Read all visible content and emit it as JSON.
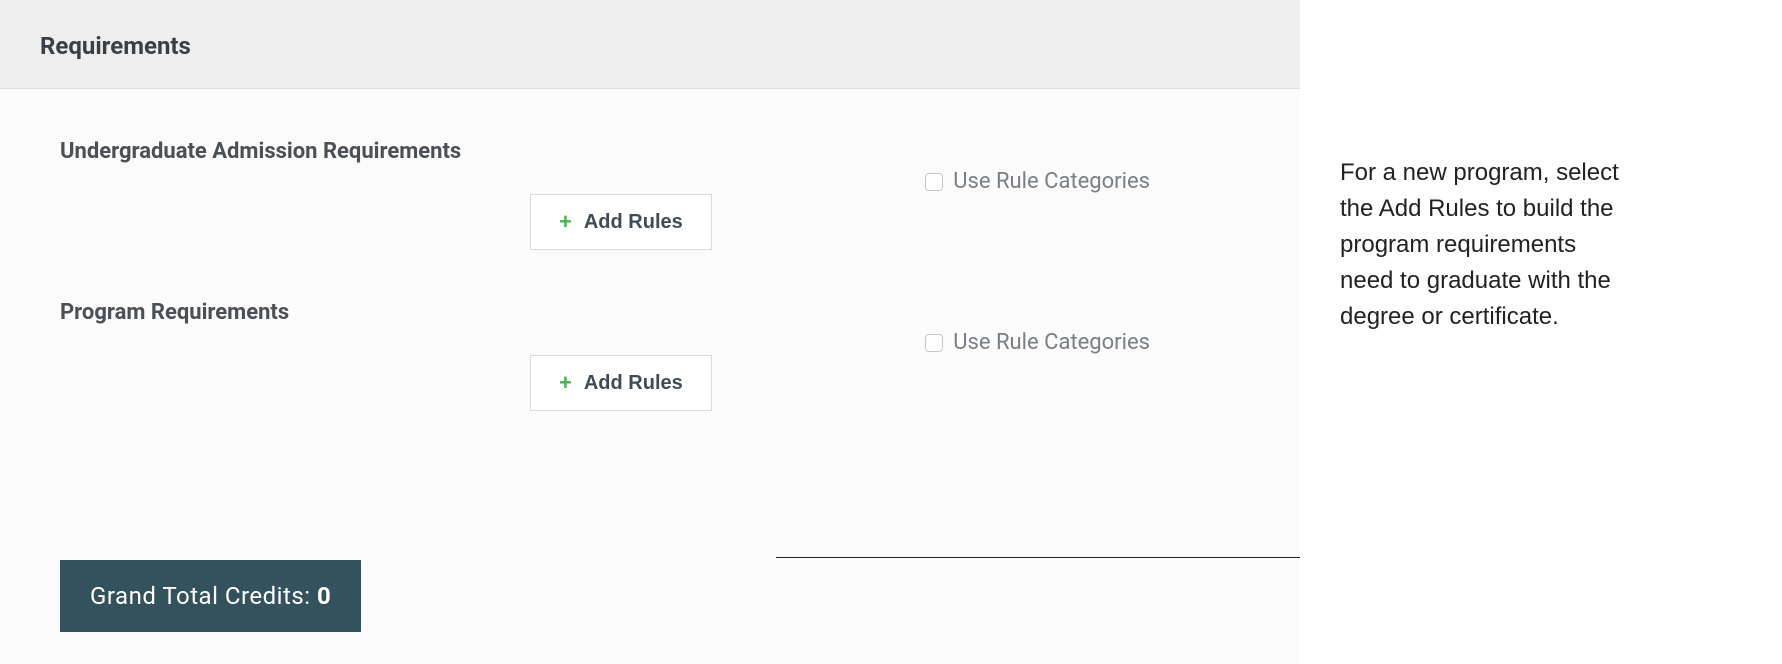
{
  "panel": {
    "title": "Requirements"
  },
  "sections": {
    "admission": {
      "title": "Undergraduate Admission Requirements",
      "checkbox_label": "Use Rule Categories",
      "add_button_label": "Add Rules"
    },
    "program": {
      "title": "Program Requirements",
      "checkbox_label": "Use Rule Categories",
      "add_button_label": "Add Rules"
    }
  },
  "grand_total": {
    "label": "Grand Total Credits: ",
    "value": "0"
  },
  "side_note": "For a new program, select the Add Rules to build the program requirements need to graduate with the degree or certificate."
}
